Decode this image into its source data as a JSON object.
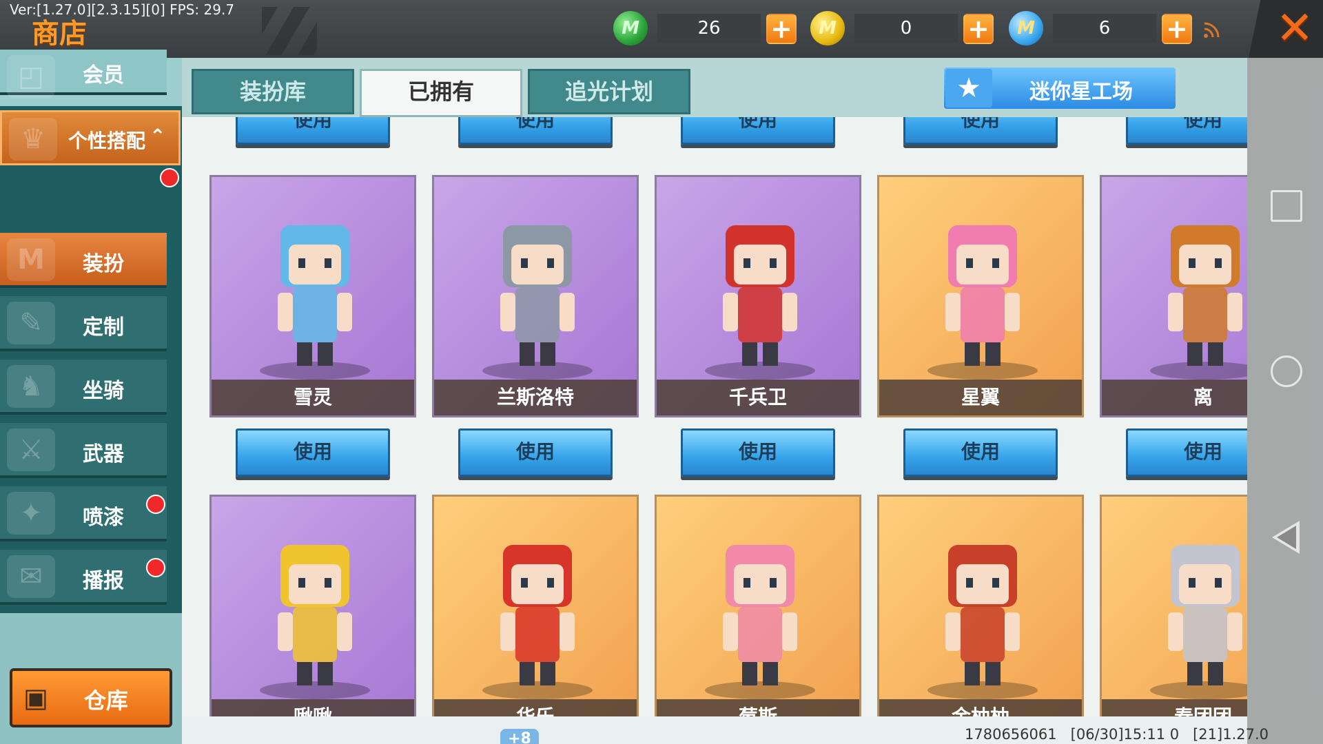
{
  "debug": {
    "version_text": "Ver:[1.27.0][2.3.15][0] FPS: 29.7"
  },
  "header": {
    "title": "商店"
  },
  "currencies": [
    {
      "icon": "mini-bean-green-coin-icon",
      "glyph": "M",
      "amount": "26"
    },
    {
      "icon": "mini-coin-gold-icon",
      "glyph": "M",
      "amount": "0"
    },
    {
      "icon": "mini-coin-blue-icon",
      "glyph": "M",
      "amount": "6"
    }
  ],
  "currency_plus": "+",
  "close_glyph": "✕",
  "sidebar": {
    "member": "会员",
    "group": "个性搭配",
    "items": [
      {
        "label": "装扮",
        "icon": "dress-up-icon",
        "badge": false,
        "active": true
      },
      {
        "label": "定制",
        "icon": "customize-icon",
        "badge": false
      },
      {
        "label": "坐骑",
        "icon": "mount-icon",
        "badge": false
      },
      {
        "label": "武器",
        "icon": "weapon-icon",
        "badge": false
      },
      {
        "label": "喷漆",
        "icon": "spray-paint-icon",
        "badge": true
      },
      {
        "label": "播报",
        "icon": "broadcast-icon",
        "badge": true
      }
    ],
    "warehouse": "仓库"
  },
  "tabs": [
    "装扮库",
    "已拥有",
    "追光计划"
  ],
  "active_tab": "已拥有",
  "studio_button": "迷你星工场",
  "use_label": "使用",
  "cards_row1": [
    {
      "name": "雪灵",
      "bg": "purple",
      "accent": "#62b8e6"
    },
    {
      "name": "兰斯洛特",
      "bg": "purple",
      "accent": "#8d98a6"
    },
    {
      "name": "千兵卫",
      "bg": "purple",
      "accent": "#d2322c"
    },
    {
      "name": "星翼",
      "bg": "orange",
      "accent": "#f07cb0"
    },
    {
      "name": "离",
      "bg": "purple",
      "accent": "#d07a2c"
    }
  ],
  "cards_row2": [
    {
      "name": "啾啾",
      "bg": "purple",
      "accent": "#f0c42e"
    },
    {
      "name": "华乐",
      "bg": "orange",
      "accent": "#d8342a"
    },
    {
      "name": "莓斯",
      "bg": "orange",
      "accent": "#f08aa8"
    },
    {
      "name": "金柚柚",
      "bg": "orange",
      "accent": "#c8402a"
    },
    {
      "name": "春团团",
      "bg": "orange",
      "accent": "#c2c4d0"
    }
  ],
  "plus_badge": "+8",
  "footer_text": "1780656061   [06/30]15:11 0   [21]1.27.0"
}
